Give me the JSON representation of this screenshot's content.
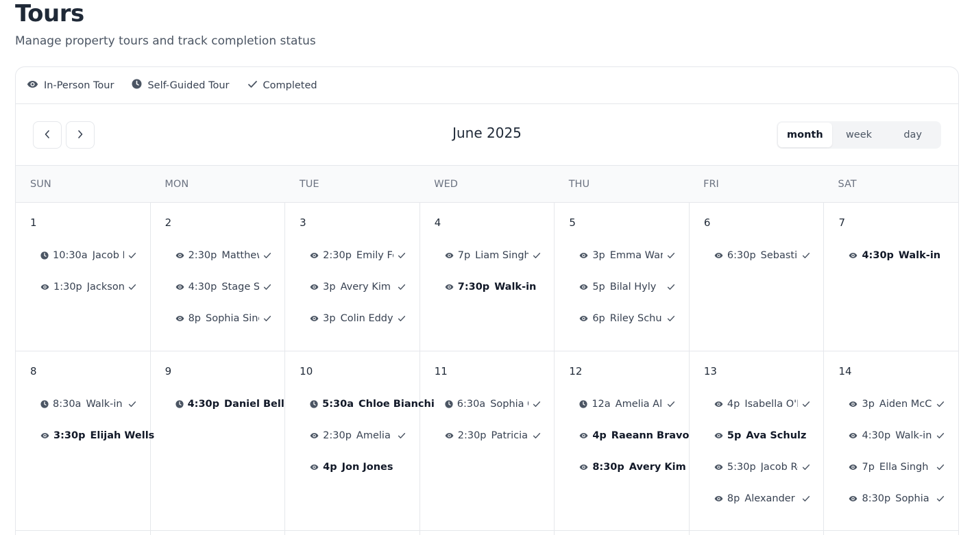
{
  "header": {
    "title": "Tours",
    "subtitle": "Manage property tours and track completion status"
  },
  "legend": {
    "in_person": "In-Person Tour",
    "self_guided": "Self-Guided Tour",
    "completed": "Completed"
  },
  "calendar": {
    "month_label": "June 2025",
    "views": {
      "month": "month",
      "week": "week",
      "day": "day"
    },
    "active_view": "month",
    "weekdays": [
      "SUN",
      "MON",
      "TUE",
      "WED",
      "THU",
      "FRI",
      "SAT"
    ],
    "weeks": [
      {
        "days": [
          {
            "num": "1",
            "events": [
              {
                "time": "10:30a",
                "name": "Jacob Ro",
                "type": "self-guided",
                "completed": true
              },
              {
                "time": "1:30p",
                "name": "Jackson Le",
                "type": "in-person",
                "completed": true
              }
            ]
          },
          {
            "num": "2",
            "events": [
              {
                "time": "2:30p",
                "name": "Matthew B",
                "type": "in-person",
                "completed": true
              },
              {
                "time": "4:30p",
                "name": "Stage Sui",
                "type": "in-person",
                "completed": true
              },
              {
                "time": "8p",
                "name": "Sophia Singh",
                "type": "in-person",
                "completed": true
              }
            ]
          },
          {
            "num": "3",
            "events": [
              {
                "time": "2:30p",
                "name": "Emily Fos",
                "type": "in-person",
                "completed": true
              },
              {
                "time": "3p",
                "name": "Avery Kim",
                "type": "in-person",
                "completed": true
              },
              {
                "time": "3p",
                "name": "Colin Eddy",
                "type": "in-person",
                "completed": true
              }
            ]
          },
          {
            "num": "4",
            "events": [
              {
                "time": "7p",
                "name": "Liam Singh",
                "type": "in-person",
                "completed": true
              },
              {
                "time": "7:30p",
                "name": "Walk-in",
                "type": "in-person",
                "completed": false
              }
            ]
          },
          {
            "num": "5",
            "events": [
              {
                "time": "3p",
                "name": "Emma Wang",
                "type": "in-person",
                "completed": true
              },
              {
                "time": "5p",
                "name": "Bilal Hyly",
                "type": "in-person",
                "completed": true
              },
              {
                "time": "6p",
                "name": "Riley Schu",
                "type": "in-person",
                "completed": true
              }
            ]
          },
          {
            "num": "6",
            "events": [
              {
                "time": "6:30p",
                "name": "Sebastian",
                "type": "in-person",
                "completed": true
              }
            ]
          },
          {
            "num": "7",
            "events": [
              {
                "time": "4:30p",
                "name": "Walk-in",
                "type": "in-person",
                "completed": false
              }
            ]
          }
        ]
      },
      {
        "days": [
          {
            "num": "8",
            "events": [
              {
                "time": "8:30a",
                "name": "Walk-in",
                "type": "self-guided",
                "completed": true
              },
              {
                "time": "3:30p",
                "name": "Elijah Wells",
                "type": "in-person",
                "completed": false
              }
            ]
          },
          {
            "num": "9",
            "events": [
              {
                "time": "4:30p",
                "name": "Daniel Bell",
                "type": "self-guided",
                "completed": false
              }
            ]
          },
          {
            "num": "10",
            "events": [
              {
                "time": "5:30a",
                "name": "Chloe Bianchi",
                "type": "self-guided",
                "completed": false
              },
              {
                "time": "2:30p",
                "name": "Amelia Ali",
                "type": "in-person",
                "completed": true
              },
              {
                "time": "4p",
                "name": "Jon Jones",
                "type": "in-person",
                "completed": false
              }
            ]
          },
          {
            "num": "11",
            "events": [
              {
                "time": "6:30a",
                "name": "Sophia Gr",
                "type": "self-guided",
                "completed": true
              },
              {
                "time": "2:30p",
                "name": "Patricia Lo",
                "type": "in-person",
                "completed": true
              }
            ]
          },
          {
            "num": "12",
            "events": [
              {
                "time": "12a",
                "name": "Amelia Ali",
                "type": "self-guided",
                "completed": true
              },
              {
                "time": "4p",
                "name": "Raeann Bravo",
                "type": "in-person",
                "completed": false
              },
              {
                "time": "8:30p",
                "name": "Avery Kim",
                "type": "in-person",
                "completed": false
              }
            ]
          },
          {
            "num": "13",
            "events": [
              {
                "time": "4p",
                "name": "Isabella O'Ne",
                "type": "in-person",
                "completed": true
              },
              {
                "time": "5p",
                "name": "Ava Schulz",
                "type": "in-person",
                "completed": false
              },
              {
                "time": "5:30p",
                "name": "Jacob Ro",
                "type": "in-person",
                "completed": true
              },
              {
                "time": "8p",
                "name": "Alexander Ki",
                "type": "in-person",
                "completed": true
              }
            ]
          },
          {
            "num": "14",
            "events": [
              {
                "time": "3p",
                "name": "Aiden McCoy",
                "type": "in-person",
                "completed": true
              },
              {
                "time": "4:30p",
                "name": "Walk-in",
                "type": "in-person",
                "completed": true
              },
              {
                "time": "7p",
                "name": "Ella Singh",
                "type": "in-person",
                "completed": true
              },
              {
                "time": "8:30p",
                "name": "Sophia Gr",
                "type": "in-person",
                "completed": true
              }
            ]
          }
        ]
      },
      {
        "days": [
          {
            "num": "",
            "events": []
          },
          {
            "num": "",
            "events": []
          },
          {
            "num": "",
            "events": []
          },
          {
            "num": "",
            "events": []
          },
          {
            "num": "",
            "events": []
          },
          {
            "num": "",
            "events": []
          },
          {
            "num": "",
            "events": []
          }
        ]
      }
    ]
  },
  "colors": {
    "text_primary": "#1f2937",
    "text_muted": "#6b7280",
    "border": "#e5e7eb",
    "icon": "#4b5563"
  }
}
